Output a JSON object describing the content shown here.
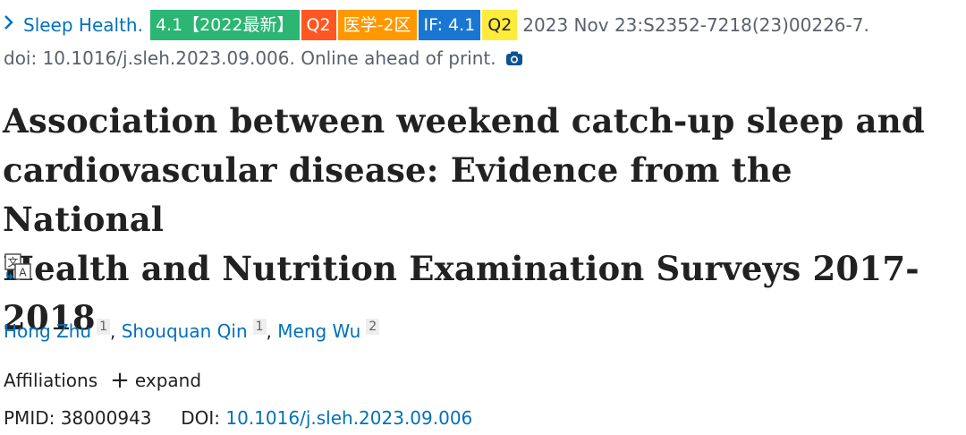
{
  "citation": {
    "chevron": ">",
    "journal": "Sleep Health.",
    "badges": [
      "4.1【2022最新】",
      "Q2",
      "医学-2区",
      "IF: 4.1",
      "Q2"
    ],
    "date_line": "2023 Nov 23:S2352-7218(23)00226-7.",
    "doi_line": "doi: 10.1016/j.sleh.2023.09.006. Online ahead of print.",
    "camera_icon": "camera-icon"
  },
  "title": {
    "line1": "Association between weekend catch-up sleep and",
    "line2": "cardiovascular disease: Evidence from the National",
    "line3": "Health and Nutrition Examination Surveys 2017-2018"
  },
  "translate_icon": "translate-icon",
  "authors": [
    {
      "name": "Hong Zhu",
      "sup": "1"
    },
    {
      "name": "Shouquan Qin",
      "sup": "1"
    },
    {
      "name": "Meng Wu",
      "sup": "2"
    }
  ],
  "author_separator": ",",
  "affiliations": {
    "label": "Affiliations",
    "toggle_icon": "+",
    "toggle_label": "expand"
  },
  "identifiers": {
    "pmid_label": "PMID:",
    "pmid": "38000943",
    "doi_label": "DOI:",
    "doi": "10.1016/j.sleh.2023.09.006"
  },
  "colors": {
    "link": "#0071bc",
    "badge_green": "#2bb673",
    "badge_red": "#ff5722",
    "badge_orange": "#ff9800",
    "badge_blue": "#1976d2",
    "badge_yellow": "#ffeb3b"
  }
}
